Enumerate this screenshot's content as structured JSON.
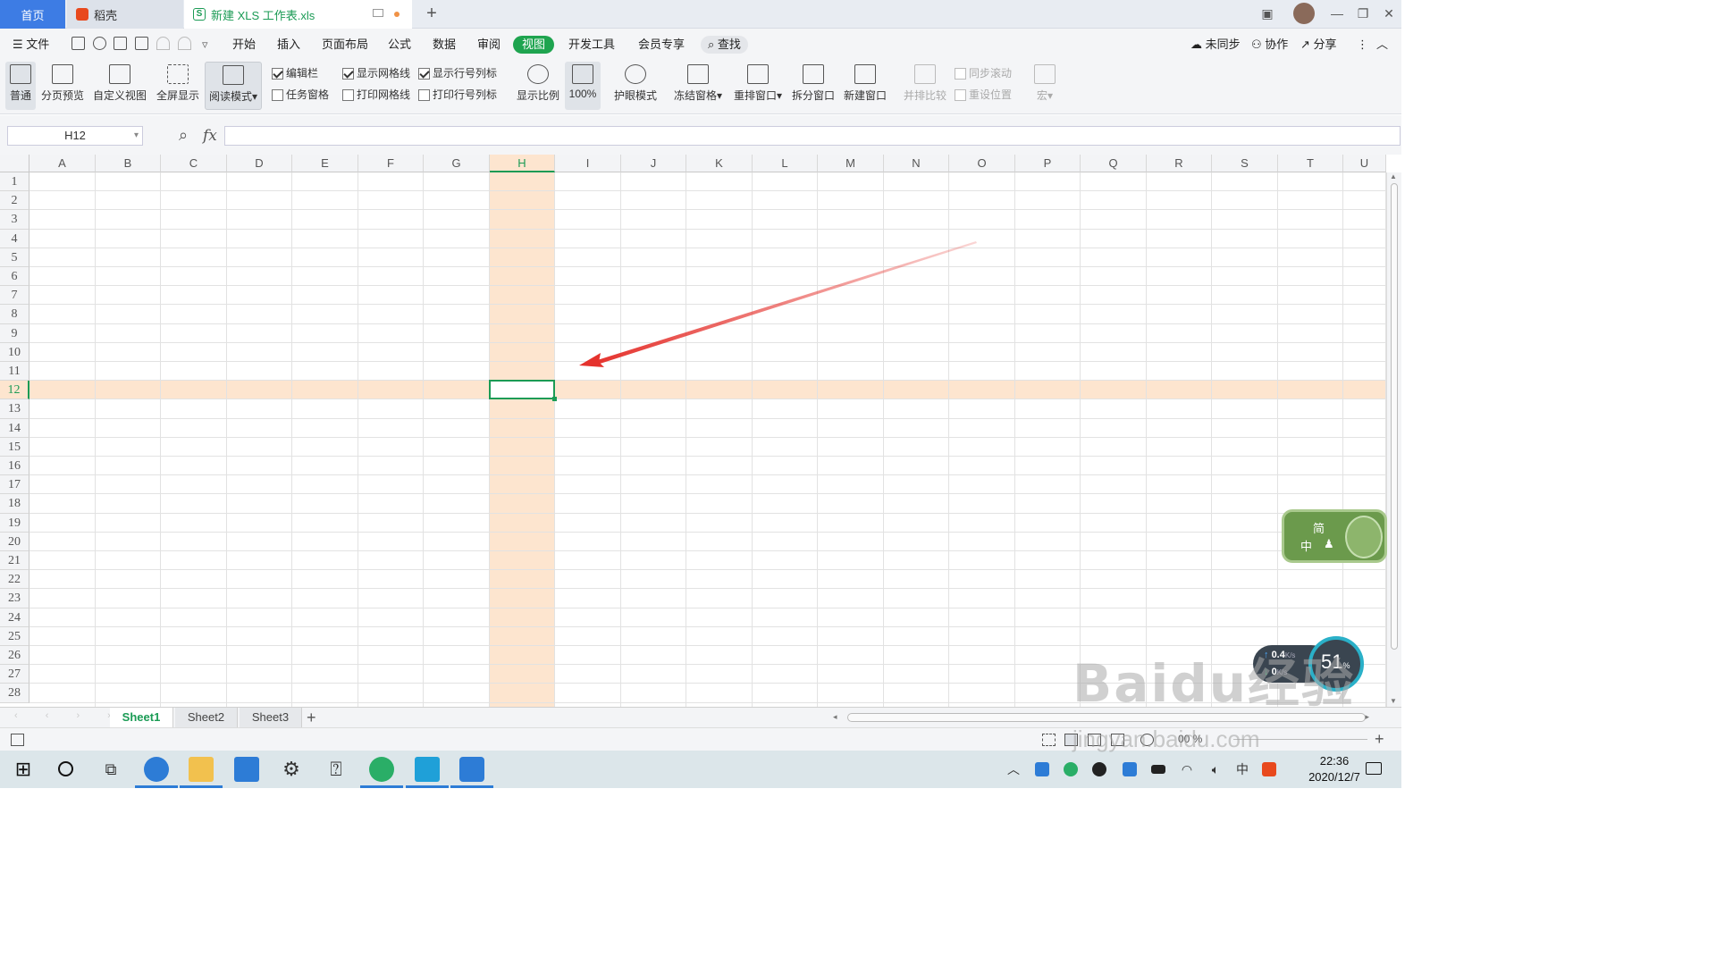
{
  "tabs": {
    "home": "首页",
    "daoke": "稻壳",
    "file": "新建 XLS 工作表.xls",
    "new_tab": "+"
  },
  "menu": {
    "file": "文件",
    "items": [
      "开始",
      "插入",
      "页面布局",
      "公式",
      "数据",
      "审阅",
      "视图",
      "开发工具",
      "会员专享"
    ],
    "active": "视图",
    "search": "查找",
    "sync": "未同步",
    "collab": "协作",
    "share": "分享"
  },
  "ribbon": {
    "normal": "普通",
    "page_break": "分页预览",
    "custom_view": "自定义视图",
    "fullscreen": "全屏显示",
    "reading_mode": "阅读模式",
    "cb_formula_bar": "编辑栏",
    "cb_task_pane": "任务窗格",
    "cb_show_grid": "显示网格线",
    "cb_print_grid": "打印网格线",
    "cb_show_headers": "显示行号列标",
    "cb_print_headers": "打印行号列标",
    "zoom": "显示比例",
    "zoom_100": "100%",
    "eye_mode": "护眼模式",
    "freeze": "冻结窗格",
    "arrange": "重排窗口",
    "split": "拆分窗口",
    "new_window": "新建窗口",
    "side_by_side": "并排比较",
    "sync_scroll": "同步滚动",
    "reset_pos": "重设位置",
    "macro": "宏"
  },
  "formula_bar": {
    "name_box": "H12",
    "fx": "fx",
    "value": ""
  },
  "grid": {
    "columns": [
      "A",
      "B",
      "C",
      "D",
      "E",
      "F",
      "G",
      "H",
      "I",
      "J",
      "K",
      "L",
      "M",
      "N",
      "O",
      "P",
      "Q",
      "R",
      "S",
      "T",
      "U"
    ],
    "rows": [
      "1",
      "2",
      "3",
      "4",
      "5",
      "6",
      "7",
      "8",
      "9",
      "10",
      "11",
      "12",
      "13",
      "14",
      "15",
      "16",
      "17",
      "18",
      "19",
      "20",
      "21",
      "22",
      "23",
      "24",
      "25",
      "26",
      "27",
      "28"
    ],
    "selected_column": "H",
    "selected_row": "12"
  },
  "sheets": {
    "tabs": [
      "Sheet1",
      "Sheet2",
      "Sheet3"
    ],
    "active": "Sheet1",
    "add": "+"
  },
  "overlays": {
    "ime_top": "简",
    "ime_bottom": "中",
    "net_up": "0.4",
    "net_up_unit": "K/s",
    "net_down": "0",
    "net_down_unit": "K/s",
    "cpu": "51",
    "cpu_unit": "%",
    "watermark": "Baidu经验",
    "watermark_url": "jingyan.baidu.com"
  },
  "status": {
    "zoom": "00 %"
  },
  "taskbar": {
    "time": "22:36",
    "date": "2020/12/7",
    "ime": "中"
  },
  "colors": {
    "accent": "#1b9b55",
    "highlight": "#fde5cf",
    "arrow": "#e5322d",
    "home_tab": "#3d7ce4"
  }
}
